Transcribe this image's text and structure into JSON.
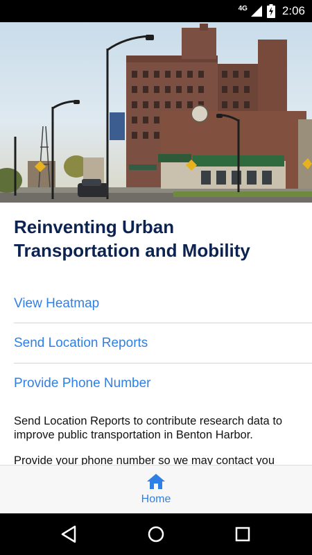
{
  "status_bar": {
    "network": "4G",
    "time": "2:06"
  },
  "hero": {
    "image": "city-street-photo"
  },
  "content": {
    "title": "Reinventing Urban Transportation and Mobility",
    "links": [
      {
        "label": "View Heatmap"
      },
      {
        "label": "Send Location Reports"
      },
      {
        "label": "Provide Phone Number"
      }
    ],
    "descriptions": [
      "Send Location Reports to contribute research data to improve public transportation in Benton Harbor.",
      "Provide your phone number so we may contact you"
    ]
  },
  "tab_bar": {
    "home_label": "Home",
    "home_icon": "home-icon"
  },
  "nav_bar": {
    "back_icon": "back-icon",
    "home_icon": "circle-home-icon",
    "recents_icon": "recents-icon"
  },
  "colors": {
    "accent": "#2f80e6",
    "title": "#0c2352"
  }
}
